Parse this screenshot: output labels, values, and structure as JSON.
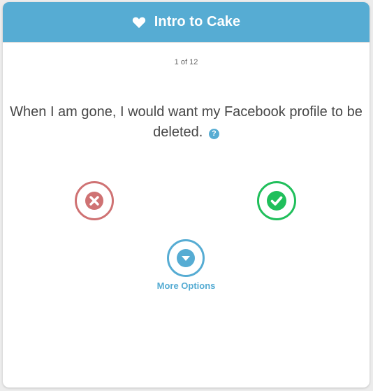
{
  "header": {
    "title": "Intro to Cake",
    "icon": "heart-icon"
  },
  "progress": {
    "label": "1 of 12",
    "current": 1,
    "total": 12
  },
  "question": {
    "text": "When I am gone, I would want my Facebook profile to be deleted.",
    "help_icon": "question-circle-icon",
    "help_glyph": "?"
  },
  "actions": {
    "no_icon": "x-icon",
    "yes_icon": "checkmark-icon",
    "more_icon": "chevron-down-icon",
    "more_label": "More Options"
  },
  "colors": {
    "brand": "#56acd3",
    "no": "#cf7273",
    "yes": "#20bf5b",
    "text": "#474747"
  }
}
